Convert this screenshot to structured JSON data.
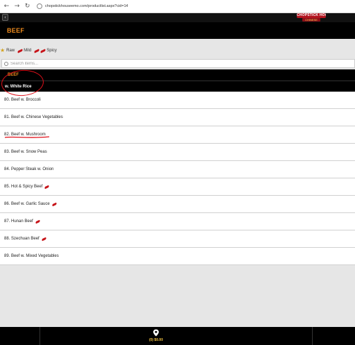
{
  "browser": {
    "url": "chopstickhouseemo.com/productlist.aspx?cid=14"
  },
  "header": {
    "back_icon": "chevron-left-icon",
    "logo_line1": "CHOPSTICK HOUSE",
    "logo_line2": "CHINESE",
    "page_title": "BEEF"
  },
  "legend": {
    "raw": "Raw",
    "mild": "Mild",
    "spicy": "Spicy",
    "colors": {
      "star": "#d4a21c",
      "pepper": "#c7151a"
    }
  },
  "search": {
    "placeholder": "Search items..."
  },
  "category": {
    "name": "BEEF",
    "subcategory": "w. White Rice"
  },
  "items": [
    {
      "label": "80. Beef w. Broccoli",
      "spicy": false
    },
    {
      "label": "81. Beef w. Chinese Vegetables",
      "spicy": false
    },
    {
      "label": "82. Beef w. Mushroom",
      "spicy": false
    },
    {
      "label": "83. Beef w. Snow Peas",
      "spicy": false
    },
    {
      "label": "84. Pepper Steak w. Onion",
      "spicy": false
    },
    {
      "label": "85. Hot & Spicy Beef",
      "spicy": true
    },
    {
      "label": "86. Beef w. Garlic Sauce",
      "spicy": true
    },
    {
      "label": "87. Hunan Beef",
      "spicy": true
    },
    {
      "label": "88. Szechuan Beef",
      "spicy": true
    },
    {
      "label": "89. Beef w. Mixed Vegetables",
      "spicy": false
    }
  ],
  "footer": {
    "cart_text": "(0) $0.00",
    "cart_icon": "cart-pin-icon"
  },
  "colors": {
    "accent": "#f08c1e",
    "header_bg": "#000000",
    "annotation": "#e0101a"
  }
}
